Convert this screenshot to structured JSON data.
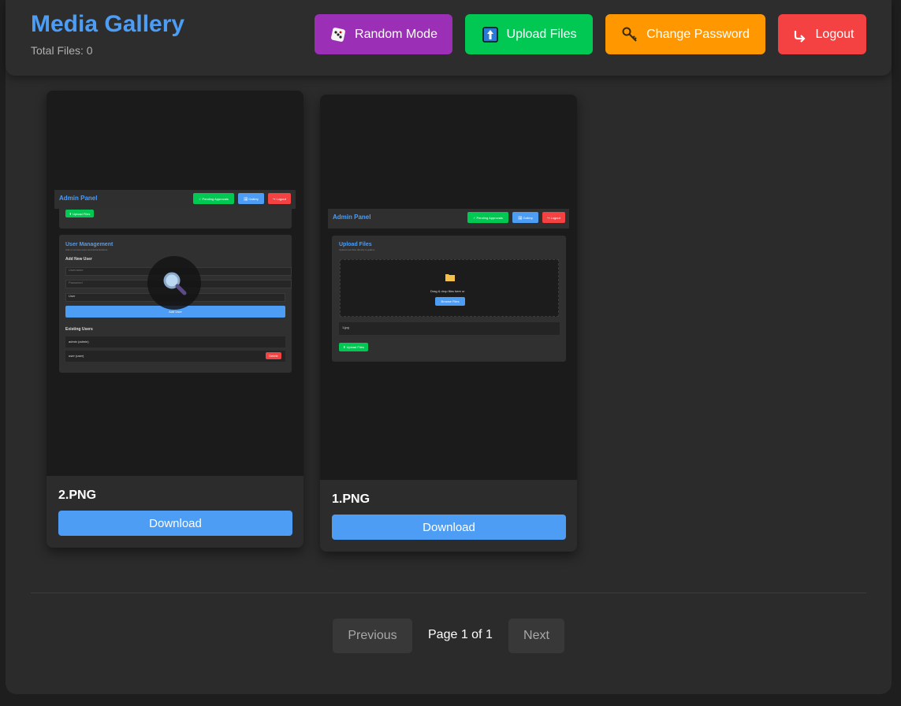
{
  "header": {
    "title": "Media Gallery",
    "total_files": "Total Files: 0",
    "buttons": {
      "random": "Random Mode",
      "upload": "Upload Files",
      "password": "Change Password",
      "logout": "Logout"
    }
  },
  "cards": [
    {
      "filename": "2.PNG",
      "download_label": "Download",
      "preview": {
        "title": "Admin Panel",
        "btn_pending": "✓ Pending Approvals",
        "btn_gallery": "🖼 Gallery",
        "btn_logout": "↪ Logout",
        "btn_upload": "⬆ Upload Files",
        "section_title": "User Management",
        "section_subtitle": "Add or remove users and administrators",
        "add_new_user": "Add New User",
        "username_placeholder": "Username",
        "password_placeholder": "Password",
        "role_select": "User",
        "add_user_btn": "Add User",
        "existing_users": "Existing Users",
        "user_1": "admin (admin)",
        "user_2": "user (user)",
        "delete_btn": "Delete"
      }
    },
    {
      "filename": "1.PNG",
      "download_label": "Download",
      "preview": {
        "title": "Admin Panel",
        "btn_pending": "✓ Pending Approvals",
        "btn_gallery": "🖼 Gallery",
        "btn_logout": "↪ Logout",
        "section_title": "Upload Files",
        "section_subtitle": "Upload new files directly to gallery",
        "drop_text": "Drag & drop files here or",
        "browse_btn": "Browse Files",
        "file_row": "1.jpg",
        "upload_btn": "⬆ Upload Files"
      }
    }
  ],
  "pagination": {
    "previous": "Previous",
    "info": "Page 1 of 1",
    "next": "Next"
  },
  "colors": {
    "accent": "#4d9df5",
    "random": "#9b2fb5",
    "upload": "#00c853",
    "password": "#ff9800",
    "logout": "#f44242"
  }
}
